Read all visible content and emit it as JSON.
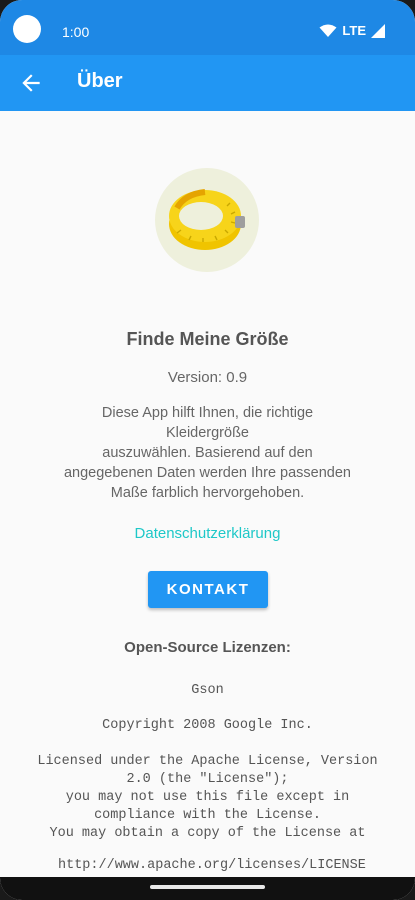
{
  "status_bar": {
    "time": "1:00",
    "network": "LTE"
  },
  "app_bar": {
    "title": "Über"
  },
  "about": {
    "app_name": "Finde Meine Größe",
    "version": "Version: 0.9",
    "description": "Diese App hilft Ihnen, die richtige\nKleidergröße\nauszuwählen. Basierend auf den\nangegebenen Daten werden Ihre passenden\nMaße farblich hervorgehoben.",
    "privacy_link": "Datenschutzerklärung",
    "contact_button": "KONTAKT"
  },
  "licenses": {
    "heading": "Open-Source Lizenzen:",
    "library": "Gson",
    "copyright": "Copyright 2008 Google Inc.",
    "text": "Licensed under the Apache License, Version\n2.0 (the \"License\");\nyou may not use this file except in\ncompliance with the License.\nYou may obtain a copy of the License at",
    "url": "http://www.apache.org/licenses/LICENSE"
  },
  "colors": {
    "status_bar": "#1e88e5",
    "app_bar": "#2196f3",
    "link": "#1ec8c8",
    "button": "#2196f3"
  },
  "icons": [
    "wifi-icon",
    "signal-icon",
    "back-arrow-icon",
    "tape-measure-icon"
  ]
}
